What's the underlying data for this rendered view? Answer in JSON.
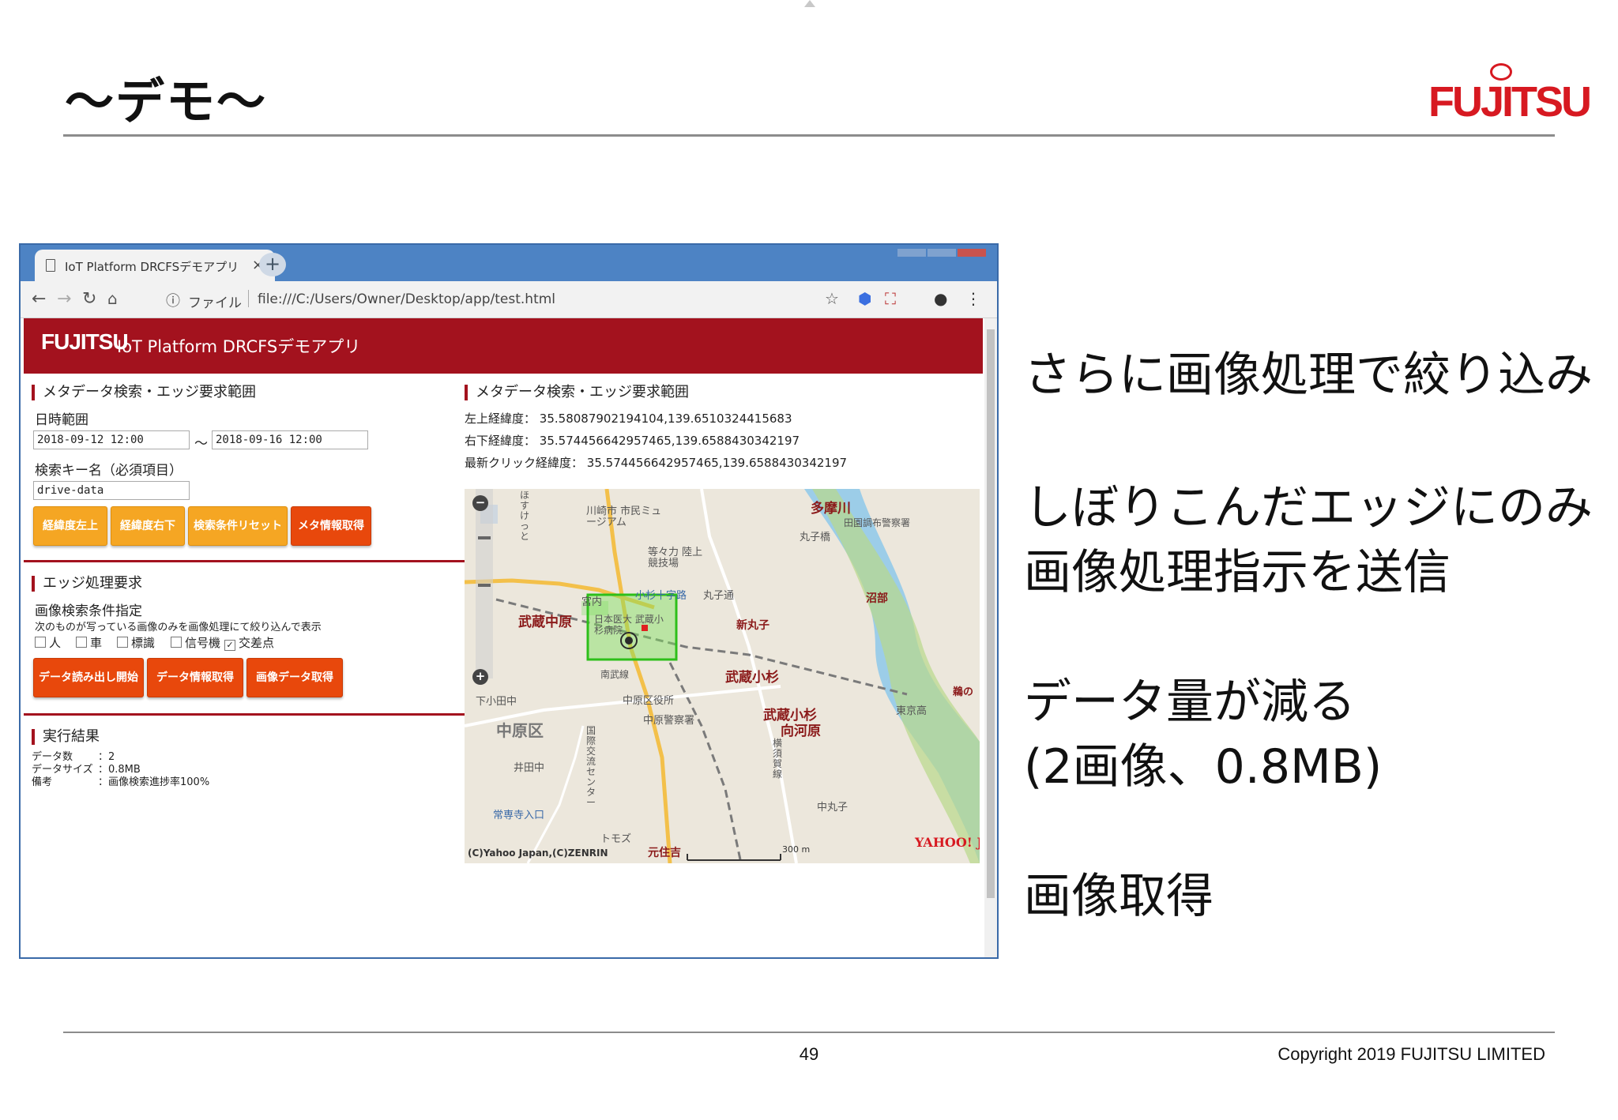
{
  "slide": {
    "title": "〜デモ〜",
    "logo_text": "FUJITSU",
    "page_number": "49",
    "copyright": "Copyright 2019 FUJITSU LIMITED",
    "bullets": [
      "さらに画像処理で絞り込み",
      "しぼりこんだエッジにのみ",
      "画像処理指示を送信",
      "データ量が減る",
      "(2画像、0.8MB)",
      "画像取得"
    ]
  },
  "browser": {
    "tab_title": "IoT Platform DRCFSデモアプリ",
    "tab_close": "×",
    "new_tab": "+",
    "url_scheme_label": "ファイル",
    "url": "file:///C:/Users/Owner/Desktop/app/test.html"
  },
  "app": {
    "logo": "FUJITSU",
    "name": "IoT Platform DRCFSデモアプリ",
    "search": {
      "title": "メタデータ検索・エッジ要求範囲",
      "datetime_label": "日時範囲",
      "date_from": "2018-09-12 12:00",
      "range_sep": "〜",
      "date_to": "2018-09-16 12:00",
      "key_label": "検索キー名（必須項目）",
      "key_value": "drive-data",
      "buttons": [
        "経緯度左上",
        "経緯度右下",
        "検索条件リセット",
        "メタ情報取得"
      ]
    },
    "range": {
      "title": "メタデータ検索・エッジ要求範囲",
      "rows": [
        {
          "label": "左上経緯度：",
          "value": "35.58087902194104,139.6510324415683"
        },
        {
          "label": "右下経緯度：",
          "value": "35.574456642957465,139.6588430342197"
        },
        {
          "label": "最新クリック経緯度：",
          "value": "35.574456642957465,139.6588430342197"
        }
      ]
    },
    "edge": {
      "title": "エッジ処理要求",
      "cond_label": "画像検索条件指定",
      "hint": "次のものが写っている画像のみを画像処理にて絞り込んで表示",
      "checks": [
        {
          "label": "人",
          "checked": false
        },
        {
          "label": "車",
          "checked": false
        },
        {
          "label": "標識",
          "checked": false
        },
        {
          "label": "信号機",
          "checked": false
        },
        {
          "label": "交差点",
          "checked": true
        }
      ],
      "buttons": [
        "データ読み出し開始",
        "データ情報取得",
        "画像データ取得"
      ]
    },
    "result": {
      "title": "実行結果",
      "rows": [
        {
          "label": "データ数",
          "value": "：2"
        },
        {
          "label": "データサイズ",
          "value": "：0.8MB"
        },
        {
          "label": "備考",
          "value": "：画像検索進捗率100%"
        }
      ]
    },
    "map": {
      "zoom_in": "+",
      "zoom_out": "−",
      "labels": [
        "多摩川",
        "武蔵中原",
        "新丸子",
        "武蔵小杉",
        "武蔵小杉",
        "向河原",
        "沼部",
        "川崎市 市民ミュージアム",
        "等々力 陸上競技場",
        "日本医大 武蔵小杉病院",
        "中原区役所",
        "中原警察署",
        "中原区",
        "下小田中",
        "井田中",
        "小杉十字路",
        "丸子通",
        "宮内",
        "常専寺入口",
        "トモズ",
        "元住吉",
        "東京高",
        "鵜の",
        "田園調布警察署",
        "丸子橋",
        "南武線",
        "中丸子",
        "国際交流センター",
        "横須賀線",
        "ほすけっと"
      ],
      "scale": "300 m",
      "attribution": "(C)Yahoo Japan,(C)ZENRIN",
      "brand": "YAHOO! JAPAN"
    }
  }
}
